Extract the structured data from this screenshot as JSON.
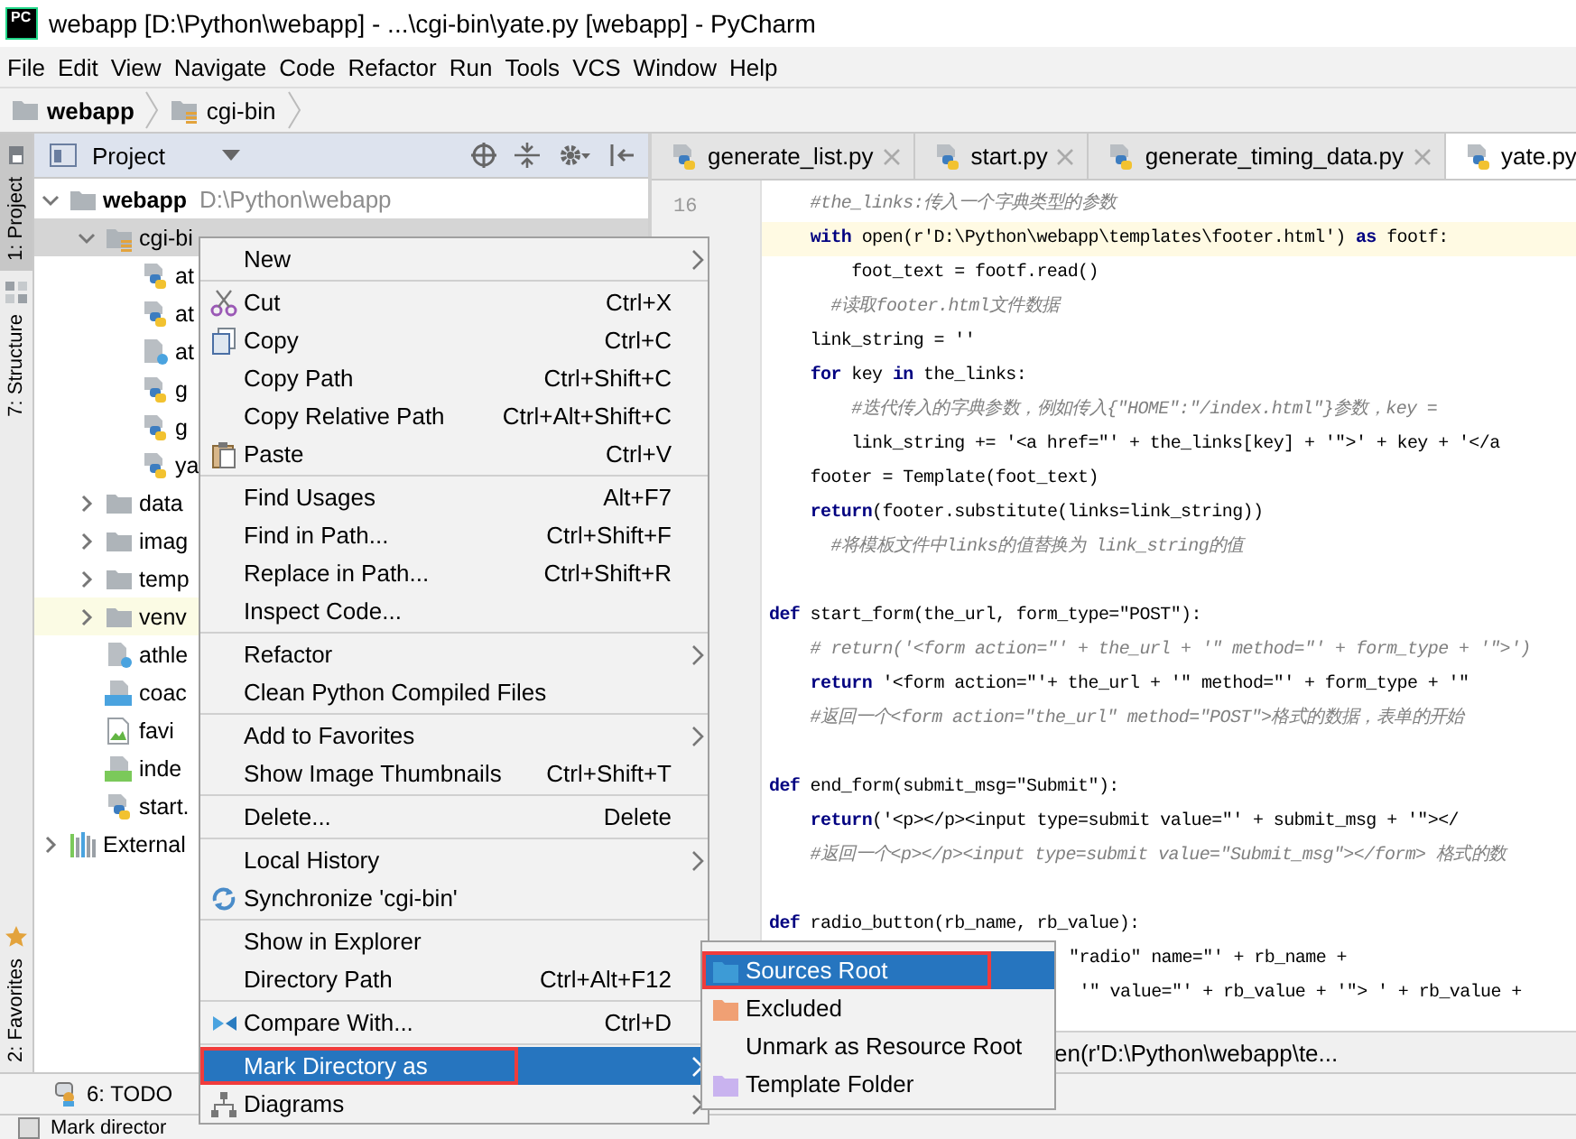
{
  "window": {
    "title": "webapp [D:\\Python\\webapp] - ...\\cgi-bin\\yate.py [webapp] - PyCharm",
    "logo_text": "PC"
  },
  "menu_bar": [
    "File",
    "Edit",
    "View",
    "Navigate",
    "Code",
    "Refactor",
    "Run",
    "Tools",
    "VCS",
    "Window",
    "Help"
  ],
  "breadcrumb": [
    {
      "label": "webapp",
      "kind": "project"
    },
    {
      "label": "cgi-bin",
      "kind": "folder"
    }
  ],
  "tool_strip": [
    {
      "label": "1: Project",
      "selected": true
    },
    {
      "label": "7: Structure",
      "selected": false
    },
    {
      "label": "2: Favorites",
      "selected": false
    }
  ],
  "project_panel": {
    "title": "Project",
    "tree": [
      {
        "label": "webapp",
        "path": "D:\\Python\\webapp",
        "kind": "folder",
        "expanded": true,
        "selected": false,
        "highlighted": false,
        "children": [
          {
            "label": "cgi-bi",
            "kind": "source-folder",
            "expanded": true,
            "selected": true,
            "highlighted": false,
            "children": [
              {
                "label": "at",
                "kind": "python",
                "selected": false,
                "highlighted": false
              },
              {
                "label": "at",
                "kind": "python",
                "selected": false,
                "highlighted": false
              },
              {
                "label": "at",
                "kind": "unknown",
                "selected": false,
                "highlighted": false
              },
              {
                "label": "g",
                "kind": "python",
                "selected": false,
                "highlighted": false
              },
              {
                "label": "g",
                "kind": "python",
                "selected": false,
                "highlighted": false
              },
              {
                "label": "ya",
                "kind": "python",
                "selected": false,
                "highlighted": false
              }
            ]
          },
          {
            "label": "data",
            "kind": "folder",
            "expanded": false,
            "selected": false,
            "highlighted": false
          },
          {
            "label": "imag",
            "kind": "folder",
            "expanded": false,
            "selected": false,
            "highlighted": false
          },
          {
            "label": "temp",
            "kind": "folder",
            "expanded": false,
            "selected": false,
            "highlighted": false
          },
          {
            "label": "venv",
            "kind": "folder",
            "expanded": false,
            "selected": false,
            "highlighted": true
          },
          {
            "label": "athle",
            "kind": "unknown",
            "selected": false,
            "highlighted": false
          },
          {
            "label": "coac",
            "kind": "css",
            "selected": false,
            "highlighted": false
          },
          {
            "label": "favi",
            "kind": "image",
            "selected": false,
            "highlighted": false
          },
          {
            "label": "inde",
            "kind": "html",
            "selected": false,
            "highlighted": false
          },
          {
            "label": "start.",
            "kind": "python",
            "selected": false,
            "highlighted": false
          }
        ]
      },
      {
        "label": "External",
        "kind": "library",
        "expanded": false,
        "selected": false,
        "highlighted": false
      }
    ]
  },
  "editor": {
    "tabs": [
      {
        "label": "generate_list.py",
        "selected": false
      },
      {
        "label": "start.py",
        "selected": false
      },
      {
        "label": "generate_timing_data.py",
        "selected": false
      },
      {
        "label": "yate.py",
        "selected": true
      }
    ],
    "line_number": "16",
    "lines": [
      {
        "kind": "comment",
        "text": "    #the_links:传入一个字典类型的参数",
        "current": false
      },
      {
        "kind": "code",
        "text": "    **with** open(r'D:\\Python\\webapp\\templates\\footer.html') **as** footf:",
        "current": true
      },
      {
        "kind": "code",
        "text": "        foot_text = footf.read()",
        "current": false
      },
      {
        "kind": "comment",
        "text": "      #读取footer.html文件数据",
        "current": false
      },
      {
        "kind": "code",
        "text": "    link_string = ''",
        "current": false
      },
      {
        "kind": "code",
        "text": "    **for** key **in** the_links:",
        "current": false
      },
      {
        "kind": "comment",
        "text": "        #迭代传入的字典参数，例如传入{\"HOME\":\"/index.html\"}参数，key =",
        "current": false
      },
      {
        "kind": "code",
        "text": "        link_string += '<a href=\"' + the_links[key] + '\">' + key + '</a",
        "current": false
      },
      {
        "kind": "code",
        "text": "    footer = Template(foot_text)",
        "current": false
      },
      {
        "kind": "code",
        "text": "    **return**(footer.substitute(links=link_string))",
        "current": false
      },
      {
        "kind": "comment",
        "text": "      #将模板文件中links的值替换为 link_string的值",
        "current": false
      },
      {
        "kind": "blank"
      },
      {
        "kind": "code",
        "text": "**def** start_form(the_url, form_type=\"POST\"):",
        "current": false
      },
      {
        "kind": "comment",
        "text": "    # return('<form action=\"' + the_url + '\" method=\"' + form_type + '\">')",
        "current": false
      },
      {
        "kind": "code",
        "text": "    **return** '<form action=\"'+ the_url + '\" method=\"' + form_type + '\"",
        "current": false
      },
      {
        "kind": "comment",
        "text": "    #返回一个<form action=\"the_url\" method=\"POST\">格式的数据，表单的开始",
        "current": false
      },
      {
        "kind": "blank"
      },
      {
        "kind": "code",
        "text": "**def** end_form(submit_msg=\"Submit\"):",
        "current": false
      },
      {
        "kind": "code",
        "text": "    **return**('<p></p><input type=submit value=\"' + submit_msg + '\"></",
        "current": false
      },
      {
        "kind": "comment",
        "text": "    #返回一个<p></p><input type=submit value=\"Submit_msg\"></form> 格式的数",
        "current": false
      },
      {
        "kind": "blank"
      },
      {
        "kind": "code",
        "text": "**def** radio_button(rb_name, rb_value):",
        "current": false
      },
      {
        "kind": "partial",
        "text": "\"radio\" name=\"' + rb_name +",
        "current": false
      },
      {
        "kind": "partial",
        "text": " '\" value=\"' + rb_value + '\"> ' + rb_value +",
        "current": false
      }
    ],
    "hint": "en(r'D:\\Python\\webapp\\te..."
  },
  "context_menu": {
    "items": [
      {
        "kind": "item",
        "label": "New",
        "submenu": true,
        "selected": false,
        "annotated": false
      },
      {
        "kind": "separator"
      },
      {
        "kind": "item",
        "label": "Cut",
        "shortcut": "Ctrl+X",
        "selected": false,
        "annotated": false
      },
      {
        "kind": "item",
        "label": "Copy",
        "shortcut": "Ctrl+C",
        "selected": false,
        "annotated": false
      },
      {
        "kind": "item",
        "label": "Copy Path",
        "shortcut": "Ctrl+Shift+C",
        "selected": false,
        "annotated": false
      },
      {
        "kind": "item",
        "label": "Copy Relative Path",
        "shortcut": "Ctrl+Alt+Shift+C",
        "selected": false,
        "annotated": false
      },
      {
        "kind": "item",
        "label": "Paste",
        "shortcut": "Ctrl+V",
        "selected": false,
        "annotated": false
      },
      {
        "kind": "separator"
      },
      {
        "kind": "item",
        "label": "Find Usages",
        "shortcut": "Alt+F7",
        "selected": false,
        "annotated": false
      },
      {
        "kind": "item",
        "label": "Find in Path...",
        "shortcut": "Ctrl+Shift+F",
        "selected": false,
        "annotated": false
      },
      {
        "kind": "item",
        "label": "Replace in Path...",
        "shortcut": "Ctrl+Shift+R",
        "selected": false,
        "annotated": false
      },
      {
        "kind": "item",
        "label": "Inspect Code...",
        "selected": false,
        "annotated": false
      },
      {
        "kind": "separator"
      },
      {
        "kind": "item",
        "label": "Refactor",
        "submenu": true,
        "selected": false,
        "annotated": false
      },
      {
        "kind": "item",
        "label": "Clean Python Compiled Files",
        "selected": false,
        "annotated": false
      },
      {
        "kind": "separator"
      },
      {
        "kind": "item",
        "label": "Add to Favorites",
        "submenu": true,
        "selected": false,
        "annotated": false
      },
      {
        "kind": "item",
        "label": "Show Image Thumbnails",
        "shortcut": "Ctrl+Shift+T",
        "selected": false,
        "annotated": false
      },
      {
        "kind": "separator"
      },
      {
        "kind": "item",
        "label": "Delete...",
        "shortcut": "Delete",
        "selected": false,
        "annotated": false
      },
      {
        "kind": "separator"
      },
      {
        "kind": "item",
        "label": "Local History",
        "submenu": true,
        "selected": false,
        "annotated": false
      },
      {
        "kind": "item",
        "label": "Synchronize 'cgi-bin'",
        "selected": false,
        "annotated": false
      },
      {
        "kind": "separator"
      },
      {
        "kind": "item",
        "label": "Show in Explorer",
        "selected": false,
        "annotated": false
      },
      {
        "kind": "item",
        "label": "Directory Path",
        "shortcut": "Ctrl+Alt+F12",
        "selected": false,
        "annotated": false
      },
      {
        "kind": "separator"
      },
      {
        "kind": "item",
        "label": "Compare With...",
        "shortcut": "Ctrl+D",
        "selected": false,
        "annotated": false
      },
      {
        "kind": "separator"
      },
      {
        "kind": "item",
        "label": "Mark Directory as",
        "submenu": true,
        "selected": true,
        "annotated": true
      },
      {
        "kind": "item",
        "label": "Diagrams",
        "submenu": true,
        "selected": false,
        "annotated": false
      }
    ]
  },
  "submenu": {
    "items": [
      {
        "label": "Sources Root",
        "color": "#3d9bd6",
        "selected": true,
        "annotated": true
      },
      {
        "label": "Excluded",
        "color": "#f0a074",
        "selected": false,
        "annotated": false
      },
      {
        "label": "Unmark as Resource Root",
        "selected": false,
        "annotated": false
      },
      {
        "label": "Template Folder",
        "color": "#c9b3ef",
        "selected": false,
        "annotated": false
      }
    ]
  },
  "bottom_bar": {
    "tools": [
      {
        "label": "6: TODO"
      }
    ]
  },
  "status_bar": {
    "text": "Mark director"
  }
}
